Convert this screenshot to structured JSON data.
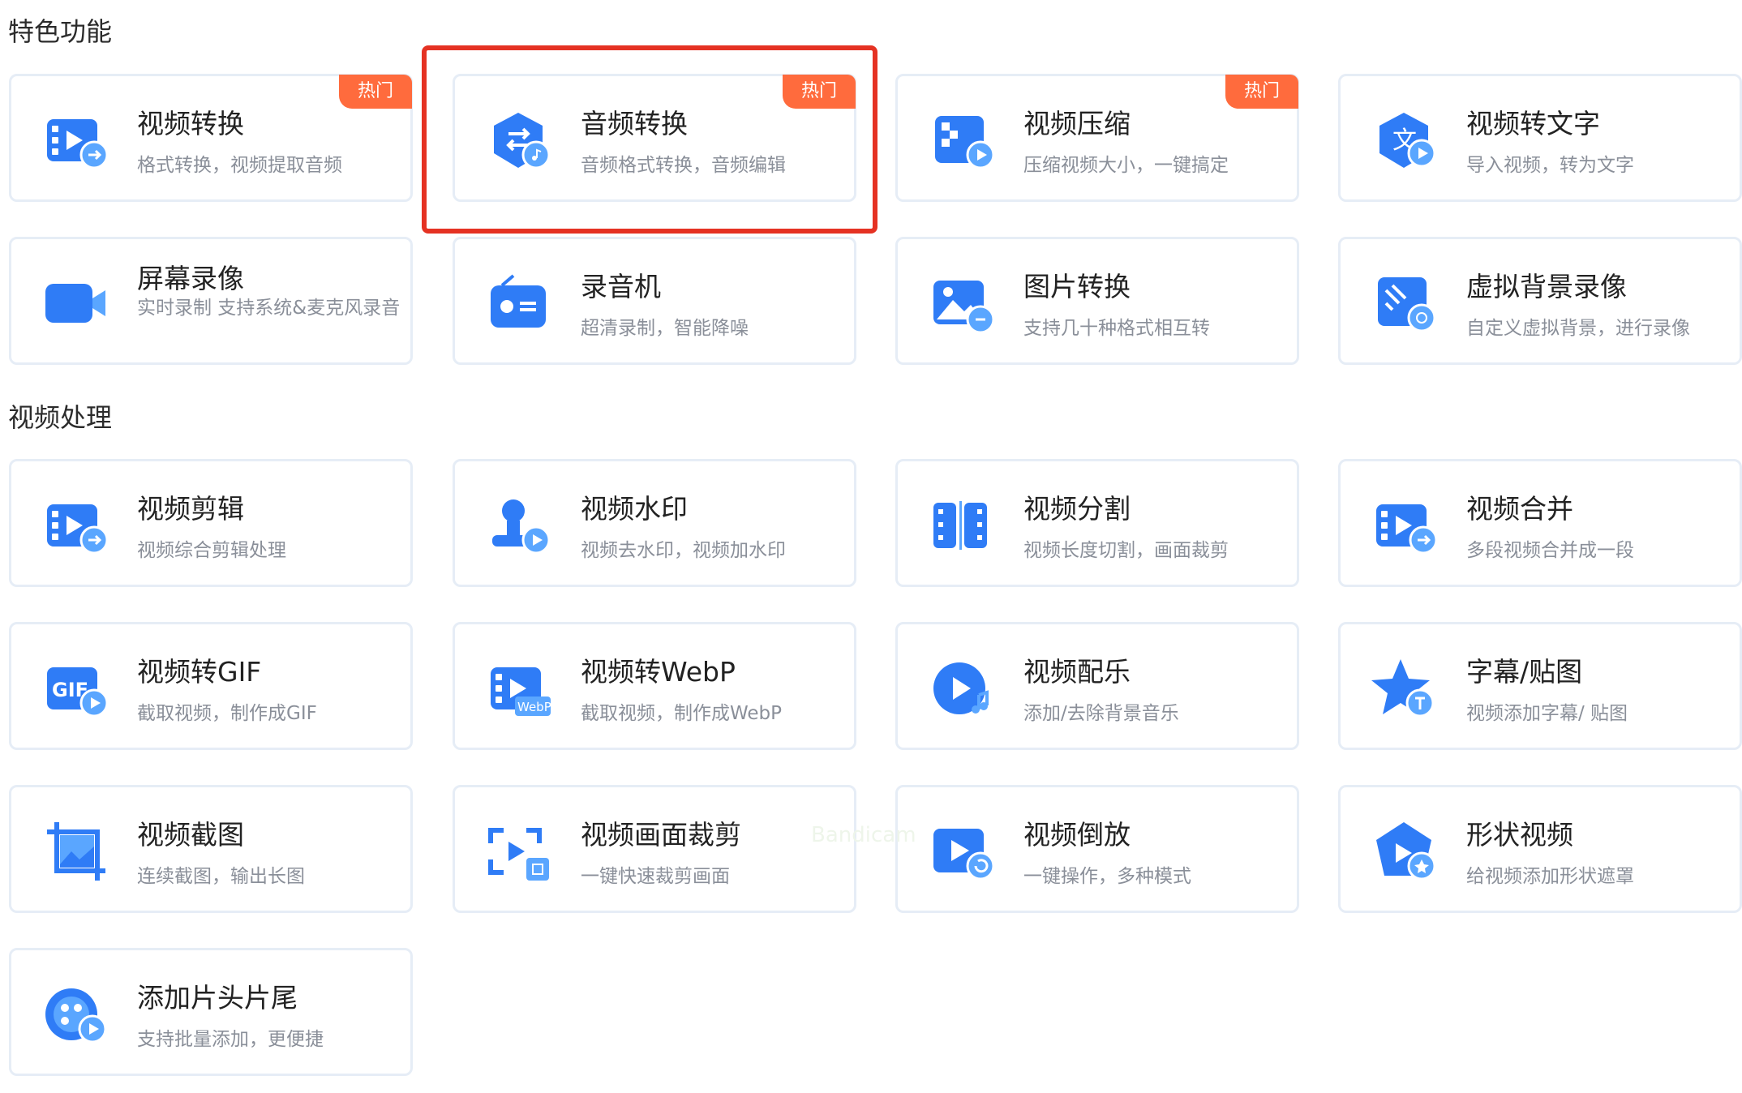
{
  "sections": {
    "featured": "特色功能",
    "video_processing": "视频处理"
  },
  "hot_label": "热门",
  "watermark": "Bandicam",
  "featured_cards": [
    {
      "title": "视频转换",
      "desc": "格式转换，视频提取音频",
      "icon": "video-convert-icon",
      "hot": true
    },
    {
      "title": "音频转换",
      "desc": "音频格式转换，音频编辑",
      "icon": "audio-convert-icon",
      "hot": true
    },
    {
      "title": "视频压缩",
      "desc": "压缩视频大小，一键搞定",
      "icon": "video-compress-icon",
      "hot": true
    },
    {
      "title": "视频转文字",
      "desc": "导入视频，转为文字",
      "icon": "video-to-text-icon",
      "hot": false
    },
    {
      "title": "屏幕录像",
      "desc": "实时录制 支持系统&麦克风录音",
      "icon": "screen-record-icon",
      "hot": false
    },
    {
      "title": "录音机",
      "desc": "超清录制，智能降噪",
      "icon": "recorder-icon",
      "hot": false
    },
    {
      "title": "图片转换",
      "desc": "支持几十种格式相互转",
      "icon": "image-convert-icon",
      "hot": false
    },
    {
      "title": "虚拟背景录像",
      "desc": "自定义虚拟背景，进行录像",
      "icon": "virtual-bg-icon",
      "hot": false
    }
  ],
  "processing_cards": [
    {
      "title": "视频剪辑",
      "desc": "视频综合剪辑处理",
      "icon": "video-edit-icon"
    },
    {
      "title": "视频水印",
      "desc": "视频去水印，视频加水印",
      "icon": "watermark-icon"
    },
    {
      "title": "视频分割",
      "desc": "视频长度切割，画面裁剪",
      "icon": "video-split-icon"
    },
    {
      "title": "视频合并",
      "desc": "多段视频合并成一段",
      "icon": "video-merge-icon"
    },
    {
      "title": "视频转GIF",
      "desc": "截取视频，制作成GIF",
      "icon": "gif-icon"
    },
    {
      "title": "视频转WebP",
      "desc": "截取视频，制作成WebP",
      "icon": "webp-icon"
    },
    {
      "title": "视频配乐",
      "desc": "添加/去除背景音乐",
      "icon": "music-icon"
    },
    {
      "title": "字幕/贴图",
      "desc": "视频添加字幕/ 贴图",
      "icon": "subtitle-icon"
    },
    {
      "title": "视频截图",
      "desc": "连续截图，输出长图",
      "icon": "screenshot-icon"
    },
    {
      "title": "视频画面裁剪",
      "desc": "一键快速裁剪画面",
      "icon": "crop-icon"
    },
    {
      "title": "视频倒放",
      "desc": "一键操作，多种模式",
      "icon": "reverse-icon"
    },
    {
      "title": "形状视频",
      "desc": "给视频添加形状遮罩",
      "icon": "shape-icon"
    },
    {
      "title": "添加片头片尾",
      "desc": "支持批量添加，更便捷",
      "icon": "intro-outro-icon"
    }
  ],
  "icon_labels": {
    "gif": "GIF",
    "webp": "WebP",
    "text": "文"
  },
  "colors": {
    "accent": "#2f7cf6",
    "accent_light": "#5aa6ff",
    "hot": "#ff6b3d",
    "highlight": "#e53223"
  }
}
